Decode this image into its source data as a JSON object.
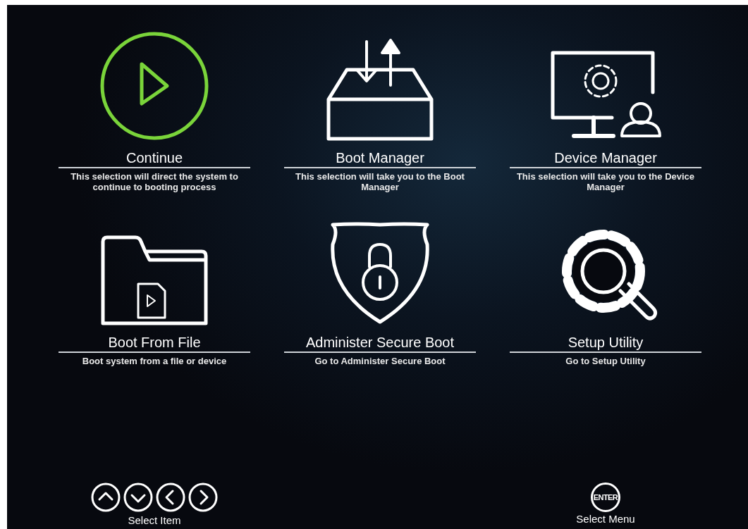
{
  "menu_items": [
    {
      "kind": "play",
      "title": "Continue",
      "description": "This selection will direct the system to continue to booting process",
      "selected": true
    },
    {
      "kind": "box",
      "title": "Boot Manager",
      "description": "This selection will take you to the Boot Manager",
      "selected": false
    },
    {
      "kind": "monitor",
      "title": "Device Manager",
      "description": "This selection will take you to the Device Manager",
      "selected": false
    },
    {
      "kind": "folder",
      "title": "Boot From File",
      "description": "Boot system from a file or device",
      "selected": false
    },
    {
      "kind": "shield",
      "title": "Administer Secure Boot",
      "description": "Go to Administer Secure Boot",
      "selected": false
    },
    {
      "kind": "gear",
      "title": "Setup Utility",
      "description": "Go to Setup Utility",
      "selected": false
    }
  ],
  "footer_hints": [
    {
      "keys": [
        {
          "kind": "up"
        },
        {
          "kind": "down"
        },
        {
          "kind": "left"
        },
        {
          "kind": "right"
        }
      ],
      "label": "Select Item"
    },
    {
      "keys": [
        {
          "kind": "text",
          "text": "ENTER"
        }
      ],
      "label": "Select Menu"
    }
  ]
}
